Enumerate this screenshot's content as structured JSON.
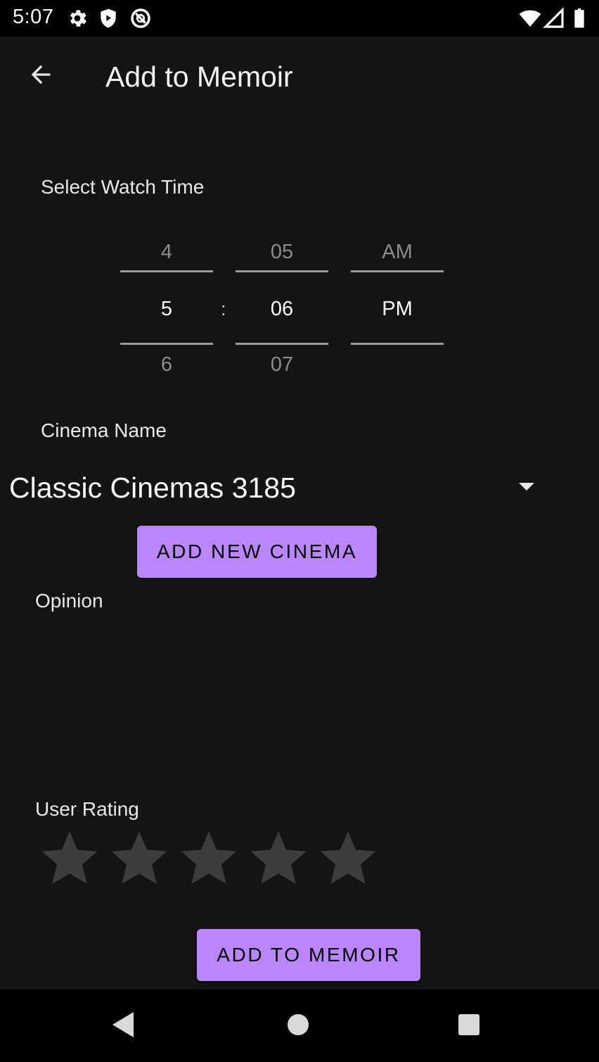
{
  "status_bar": {
    "time": "5:07",
    "icons": [
      "settings-icon",
      "shield-play-icon",
      "no-sim-icon",
      "wifi-icon",
      "signal-icon",
      "battery-icon"
    ]
  },
  "app_bar": {
    "title": "Add to Memoir",
    "back_icon": "arrow-back-icon"
  },
  "watch_time": {
    "label": "Select Watch Time",
    "hour": {
      "prev": "4",
      "current": "5",
      "next": "6"
    },
    "separator": ":",
    "minute": {
      "prev": "05",
      "current": "06",
      "next": "07"
    },
    "ampm": {
      "prev": "AM",
      "current": "PM",
      "next": ""
    }
  },
  "cinema": {
    "label": "Cinema Name",
    "selected": "Classic Cinemas 3185",
    "add_button": "ADD NEW CINEMA"
  },
  "opinion": {
    "label": "Opinion",
    "value": ""
  },
  "rating": {
    "label": "User Rating",
    "value": 0,
    "max": 5
  },
  "submit_button": "ADD TO MEMOIR",
  "colors": {
    "accent": "#bb86fc",
    "background": "#141414",
    "star_empty": "#3d3d3d"
  },
  "nav_bar": {
    "icons": [
      "back-triangle-icon",
      "home-circle-icon",
      "recents-square-icon"
    ]
  }
}
